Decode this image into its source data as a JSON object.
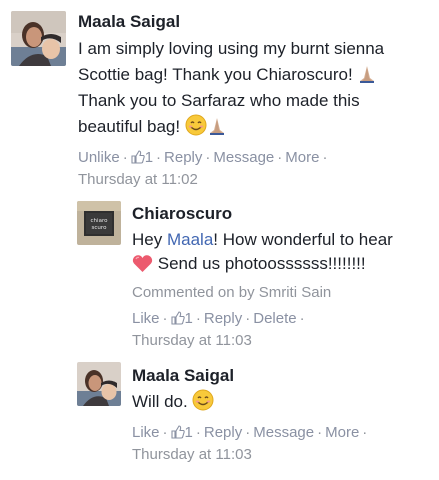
{
  "comments": [
    {
      "author": "Maala Saigal",
      "lines": [
        "I am simply loving using my burnt sienna",
        "Scottie bag! Thank you Chiaroscuro!",
        "Thank you to Sarfaraz who made this",
        "beautiful bag!"
      ],
      "actions": {
        "unlike": "Unlike",
        "like_count": "1",
        "reply": "Reply",
        "message": "Message",
        "more": "More"
      },
      "timestamp": "Thursday at 11:02"
    },
    {
      "author": "Chiaroscuro",
      "line1_pre": "Hey ",
      "mention": "Maala",
      "line1_post": "! How wonderful to hear",
      "line2": "Send us photoossssss!!!!!!!!",
      "attribution": "Commented on by Smriti Sain",
      "actions": {
        "like": "Like",
        "like_count": "1",
        "reply": "Reply",
        "delete": "Delete"
      },
      "timestamp": "Thursday at 11:03",
      "avatar_text": "chiaro scuro"
    },
    {
      "author": "Maala Saigal",
      "text": "Will do.",
      "actions": {
        "like": "Like",
        "like_count": "1",
        "reply": "Reply",
        "message": "Message",
        "more": "More"
      },
      "timestamp": "Thursday at 11:03"
    }
  ],
  "icons": {
    "thumb": "thumbs-up-icon",
    "praying": "praying-hands-emoji",
    "smile": "smiling-face-emoji",
    "heart": "heart-emoji"
  },
  "colors": {
    "link": "#8a91a3",
    "mention": "#4267b2",
    "text": "#1d2129",
    "meta": "#90949c"
  }
}
